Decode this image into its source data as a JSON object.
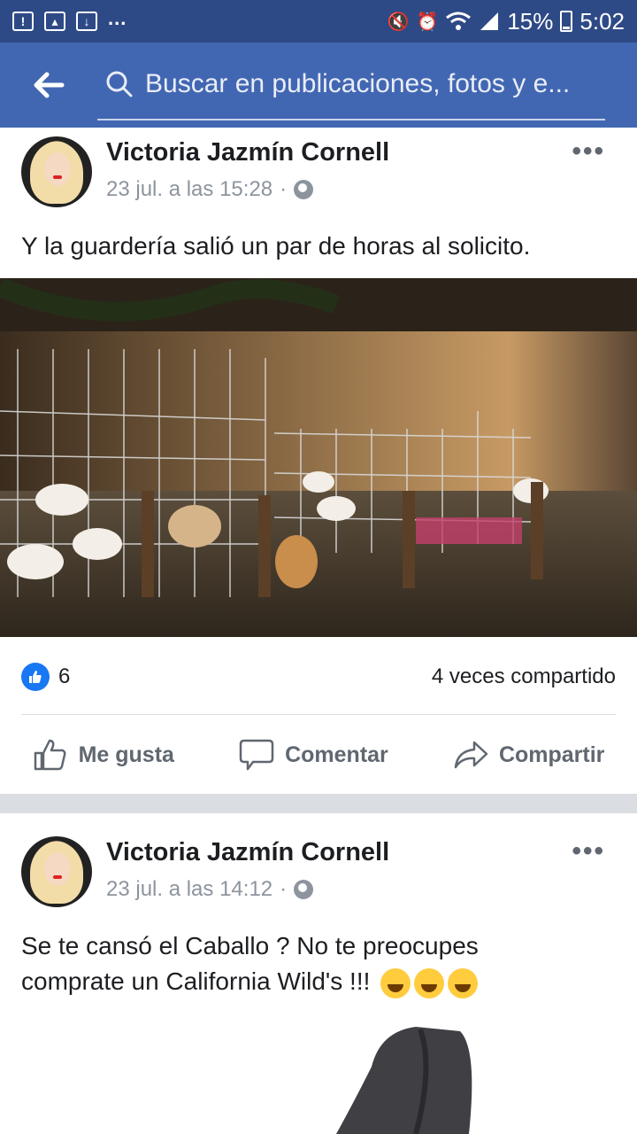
{
  "status_bar": {
    "battery": "15%",
    "time": "5:02",
    "dots": "..."
  },
  "nav": {
    "search_placeholder": "Buscar en publicaciones, fotos y e..."
  },
  "posts": [
    {
      "author": "Victoria Jazmín Cornell",
      "timestamp": "23 jul. a las 15:28",
      "text": "Y la guardería salió un par de horas al solicito.",
      "likes": "6",
      "shares": "4 veces compartido",
      "actions": {
        "like": "Me gusta",
        "comment": "Comentar",
        "share": "Compartir"
      }
    },
    {
      "author": "Victoria Jazmín Cornell",
      "timestamp": "23 jul. a las 14:12",
      "text_line1": "Se te cansó el Caballo ? No te preocupes",
      "text_line2": "comprate un California Wild's !!!"
    }
  ],
  "colors": {
    "brand": "#4267b2",
    "status_bar": "#2e4a86",
    "like_blue": "#1877f2"
  }
}
